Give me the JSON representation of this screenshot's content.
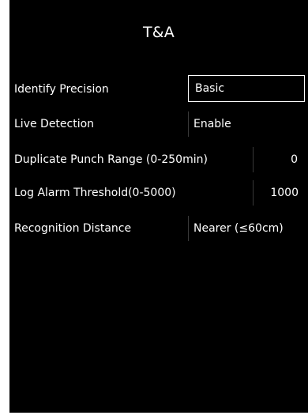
{
  "title": "T&A",
  "settings": [
    {
      "label": "Identify Precision",
      "value": "Basic"
    },
    {
      "label": "Live Detection",
      "value": "Enable"
    },
    {
      "label": "Duplicate Punch Range (0-250min)",
      "value": "0"
    },
    {
      "label": "Log Alarm Threshold(0-5000)",
      "value": "1000"
    },
    {
      "label": "Recognition Distance",
      "value": "Nearer (≤60cm)"
    }
  ]
}
